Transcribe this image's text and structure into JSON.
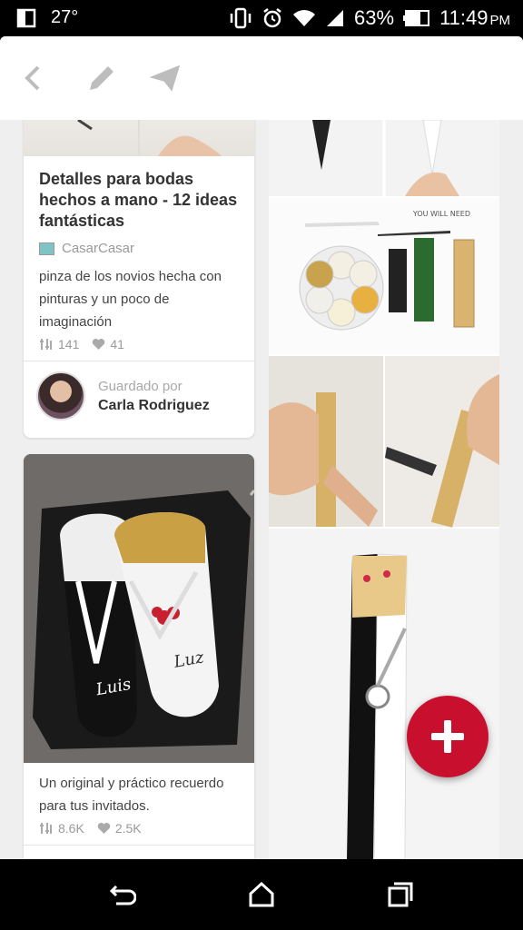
{
  "status_bar": {
    "temperature": "27°",
    "battery_percent": "63%",
    "time": "11:49",
    "ampm": "PM",
    "icons": [
      "screen-icon",
      "vibrate-icon",
      "alarm-icon",
      "wifi-icon",
      "signal-icon",
      "battery-icon"
    ]
  },
  "toolbar": {
    "icons": [
      "back-icon",
      "edit-icon",
      "send-icon"
    ]
  },
  "pin_card_1": {
    "title": "Detalles para bodas hechos a mano - 12 ideas fantásticas",
    "source": "CasarCasar",
    "description": "pinza de los novios hecha con pinturas y un poco de imaginación",
    "repins": "141",
    "likes": "41",
    "saved_by_label": "Guardado por",
    "saved_by_name": "Carla Rodriguez"
  },
  "pin_card_2": {
    "description": "Un original y práctico recuerdo para tus invitados.",
    "repins": "8.6K",
    "likes": "2.5K",
    "image_text_left": "Luis",
    "image_text_right": "Luz"
  },
  "detail_image": {
    "caption": "YOU WILL NEED"
  },
  "fab": {
    "icon": "plus-icon"
  },
  "nav_bar": {
    "icons": [
      "back-nav-icon",
      "home-nav-icon",
      "recents-nav-icon"
    ]
  },
  "colors": {
    "accent": "#c8102e",
    "background": "#efefef"
  }
}
